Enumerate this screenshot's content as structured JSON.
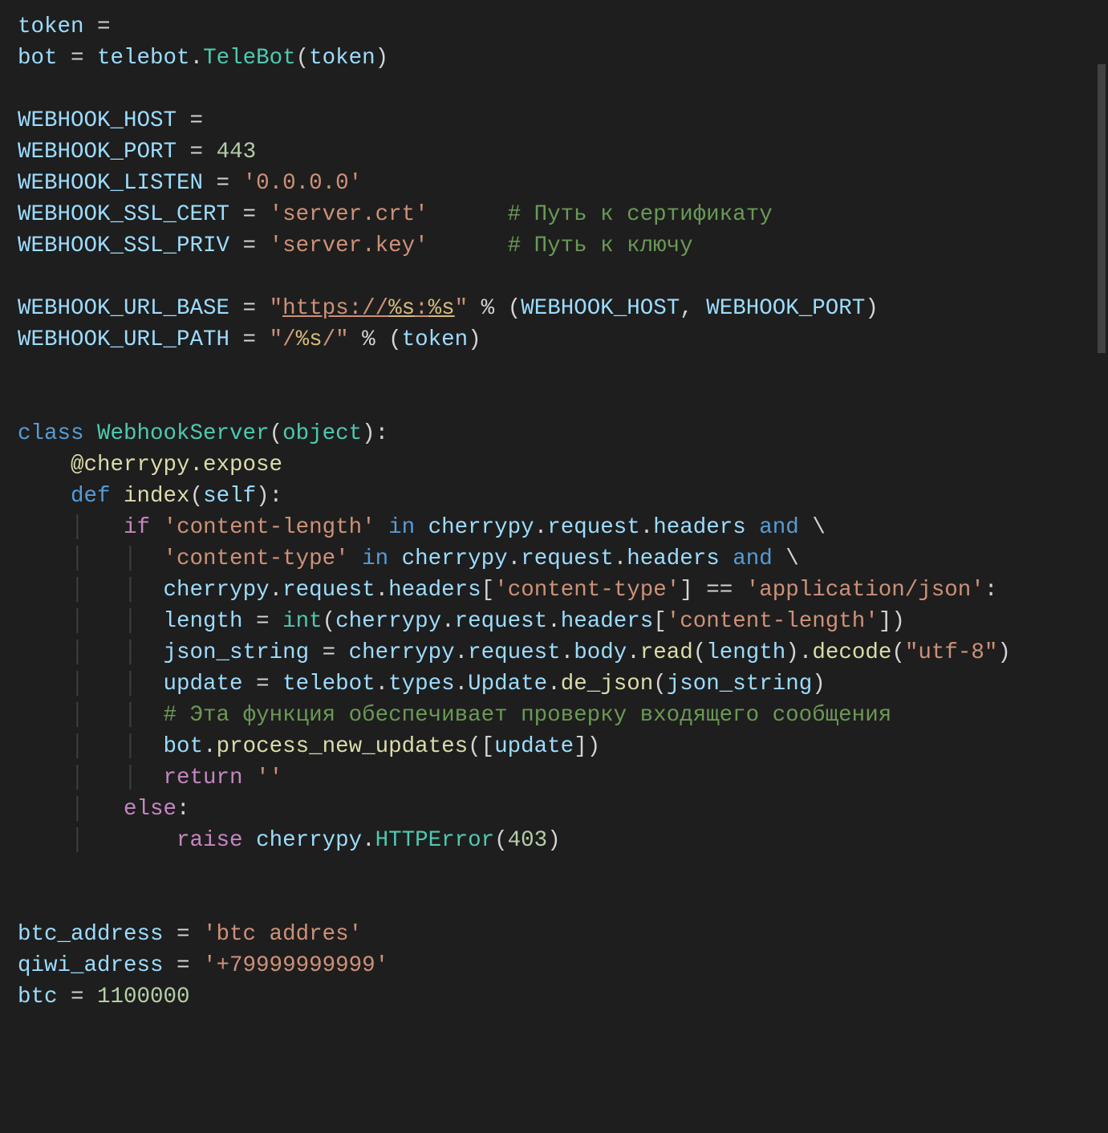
{
  "code": {
    "t_token": "token",
    "t_eq": " = ",
    "t_bot": "bot",
    "t_telebot": "telebot",
    "t_TeleBot": "TeleBot",
    "t_lpar": "(",
    "t_rpar": ")",
    "t_dot": ".",
    "t_WEBHOOK_HOST": "WEBHOOK_HOST",
    "t_WEBHOOK_PORT": "WEBHOOK_PORT",
    "t_443": "443",
    "t_WEBHOOK_LISTEN": "WEBHOOK_LISTEN",
    "t_s_0000": "'0.0.0.0'",
    "t_WEBHOOK_SSL_CERT": "WEBHOOK_SSL_CERT",
    "t_s_servercrt": "'server.crt'",
    "t_cmt_cert": "# Путь к сертификату",
    "t_WEBHOOK_SSL_PRIV": "WEBHOOK_SSL_PRIV",
    "t_s_serverkey": "'server.key'",
    "t_cmt_key": "# Путь к ключу",
    "t_WEBHOOK_URL_BASE": "WEBHOOK_URL_BASE",
    "t_q": "\"",
    "t_s_https": "https://",
    "t_s_pct_s": "%s",
    "t_s_colon": ":",
    "t_pct": " % ",
    "t_comma": ", ",
    "t_WEBHOOK_URL_PATH": "WEBHOOK_URL_PATH",
    "t_s_slash": "/",
    "t_class": "class",
    "t_WebhookServer": "WebhookServer",
    "t_object": "object",
    "t_colon": ":",
    "t_at_cherrypy_expose": "@cherrypy.expose",
    "t_def": "def",
    "t_index": "index",
    "t_self": "self",
    "t_if": "if",
    "t_s_contentlength": "'content-length'",
    "t_in": "in",
    "t_cherrypy": "cherrypy",
    "t_request": "request",
    "t_headers": "headers",
    "t_and": "and",
    "t_bslash": " \\",
    "t_s_contenttype": "'content-type'",
    "t_lbr": "[",
    "t_rbr": "]",
    "t_eqeq": " == ",
    "t_s_appjson": "'application/json'",
    "t_length": "length",
    "t_int": "int",
    "t_json_string": "json_string",
    "t_body": "body",
    "t_read": "read",
    "t_decode": "decode",
    "t_s_utf8": "\"utf-8\"",
    "t_update": "update",
    "t_types": "types",
    "t_Update": "Update",
    "t_de_json": "de_json",
    "t_cmt_check": "# Эта функция обеспечивает проверку входящего сообщения",
    "t_process_new_updates": "process_new_updates",
    "t_return": "return",
    "t_s_empty": "''",
    "t_else": "else",
    "t_raise": "raise",
    "t_HTTPError": "HTTPError",
    "t_403": "403",
    "t_btc_address": "btc_address",
    "t_s_btcaddres": "'btc addres'",
    "t_qiwi_adress": "qiwi_adress",
    "t_s_qiwi": "'+79999999999'",
    "t_btc": "btc",
    "t_1100000": "1100000"
  }
}
